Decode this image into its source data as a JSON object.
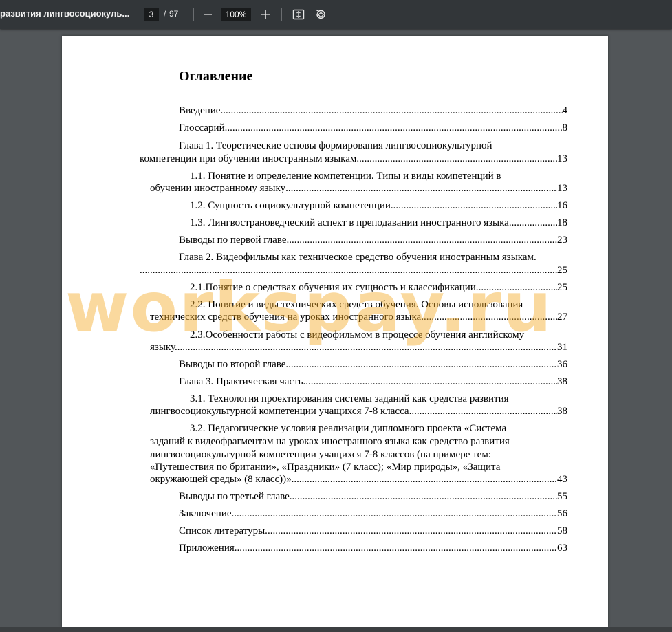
{
  "toolbar": {
    "doc_title": "развития лингвосоциокуль...",
    "current_page": "3",
    "page_sep": "/",
    "total_pages": "97",
    "zoom": "100%",
    "icons": [
      "zoom-out-icon",
      "zoom-in-icon",
      "fit-page-icon",
      "rotate-icon"
    ]
  },
  "document": {
    "toc_title": "Оглавление",
    "entries": [
      {
        "text": "Введение",
        "page": "4"
      },
      {
        "text": "Глоссарий ",
        "page": "8"
      },
      {
        "line1": "Глава 1. Теоретические основы формирования лингвосоциокультурной",
        "text": "компетенции при обучении иностранным языкам",
        "page": "13"
      },
      {
        "line1": "1.1. Понятие и определение компетенции. Типы и виды компетенций в",
        "text": "обучении иностранному языку ",
        "page": "13"
      },
      {
        "text": "1.2. Сущность социокультурной компетенции. ",
        "page": "16"
      },
      {
        "text": "1.3. Лингвострановедческий аспект в преподавании иностранного языка ",
        "page": "18"
      },
      {
        "text": "Выводы по первой главе",
        "page": "23"
      },
      {
        "line1": "Глава 2. Видеофильмы как техническое средство обучения иностранным языкам.",
        "text": "",
        "page": "25"
      },
      {
        "text": "2.1.Понятие о средствах обучения их сущность и классификации.",
        "page": "25"
      },
      {
        "line1": "2.2. Понятие и виды технических средств обучения. Основы использования",
        "text": "технических средств обучения на уроках иностранного языка.",
        "page": "27"
      },
      {
        "line1": "2.3.Особенности работы с видеофильмом в процессе обучения английскому",
        "text": "языку. ",
        "page": "31"
      },
      {
        "text": "Выводы по второй главе ",
        "page": "36"
      },
      {
        "text": "Глава 3. Практическая часть ",
        "page": "38"
      },
      {
        "line1": "3.1. Технология проектирования системы заданий как средства развития",
        "text": "лингвосоциокультурной компетенции учащихся 7-8 класса ",
        "page": "38"
      },
      {
        "line1": "3.2. Педагогические условия реализации  дипломного проекта «Система",
        "line2": "заданий к видеофрагментам на уроках иностранного языка как средство развития",
        "line3": "лингвосоциокультурной компетенции учащихся 7-8 классов (на примере тем:",
        "line4": "«Путешествия по британии», «Праздники» (7 класс); «Мир природы», «Защита",
        "text": "окружающей среды» (8 класс))». ",
        "page": "43"
      },
      {
        "text": "Выводы по третьей главе",
        "page": "55"
      },
      {
        "text": "Заключение ",
        "page": "56"
      },
      {
        "text": "Список литературы. ",
        "page": "58"
      },
      {
        "text": "Приложения ",
        "page": "63"
      }
    ]
  },
  "watermark": "workspay.ru"
}
